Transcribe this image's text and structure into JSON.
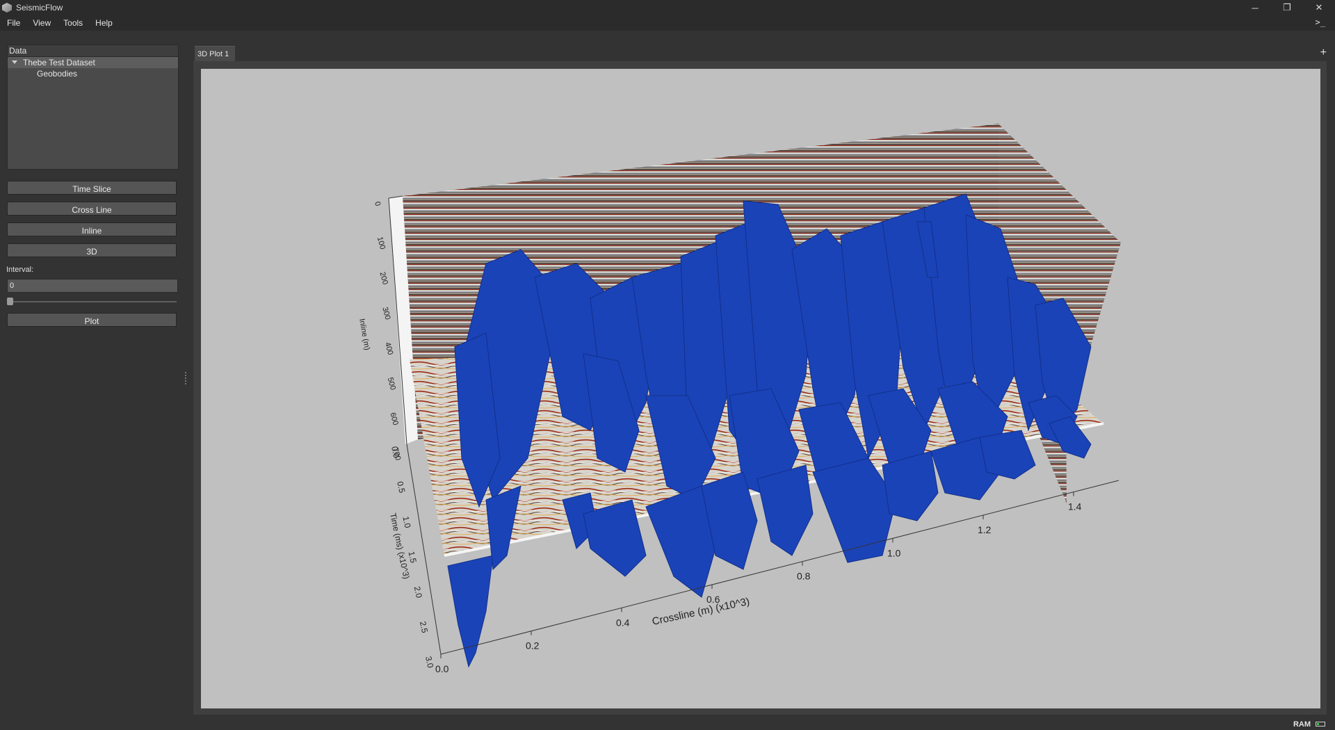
{
  "window": {
    "title": "SeismicFlow",
    "controls": {
      "minimize": "─",
      "restore": "❐",
      "close": "✕"
    }
  },
  "menu": [
    "File",
    "View",
    "Tools",
    "Help"
  ],
  "terminal_icon": "terminal-icon",
  "sidebar": {
    "data_header": "Data",
    "tree": {
      "dataset": "Thebe Test Dataset",
      "child": "Geobodies"
    },
    "buttons": {
      "time_slice": "Time Slice",
      "cross_line": "Cross Line",
      "inline": "Inline",
      "three_d": "3D",
      "plot": "Plot"
    },
    "interval_label": "Interval:",
    "interval_value": "0",
    "interval_slider_value": 0
  },
  "tab": {
    "label": "3D Plot 1",
    "add": "+"
  },
  "status": {
    "ram_label": "RAM"
  },
  "colors": {
    "background": "#333333",
    "panel": "#4a4a4a",
    "canvas": "#c0c0c0",
    "geobody": "#1b43b8"
  },
  "chart_data": {
    "type": "3d-volume",
    "xlabel": "Crossline (m) (x10^3)",
    "ylabel": "Inline (m)",
    "zlabel": "Time (ms) (x10^3)",
    "x_ticks": [
      "0.0",
      "0.2",
      "0.4",
      "0.6",
      "0.8",
      "1.0",
      "1.2",
      "1.4"
    ],
    "y_ticks": [
      "0",
      "100",
      "200",
      "300",
      "400",
      "500",
      "600",
      "700"
    ],
    "z_ticks": [
      "0.0",
      "0.5",
      "1.0",
      "1.5",
      "2.0",
      "2.5",
      "3.0"
    ],
    "layers": [
      "seismic-inline-wall",
      "seismic-crossline-wall",
      "seismic-time-slice",
      "geobodies"
    ]
  }
}
